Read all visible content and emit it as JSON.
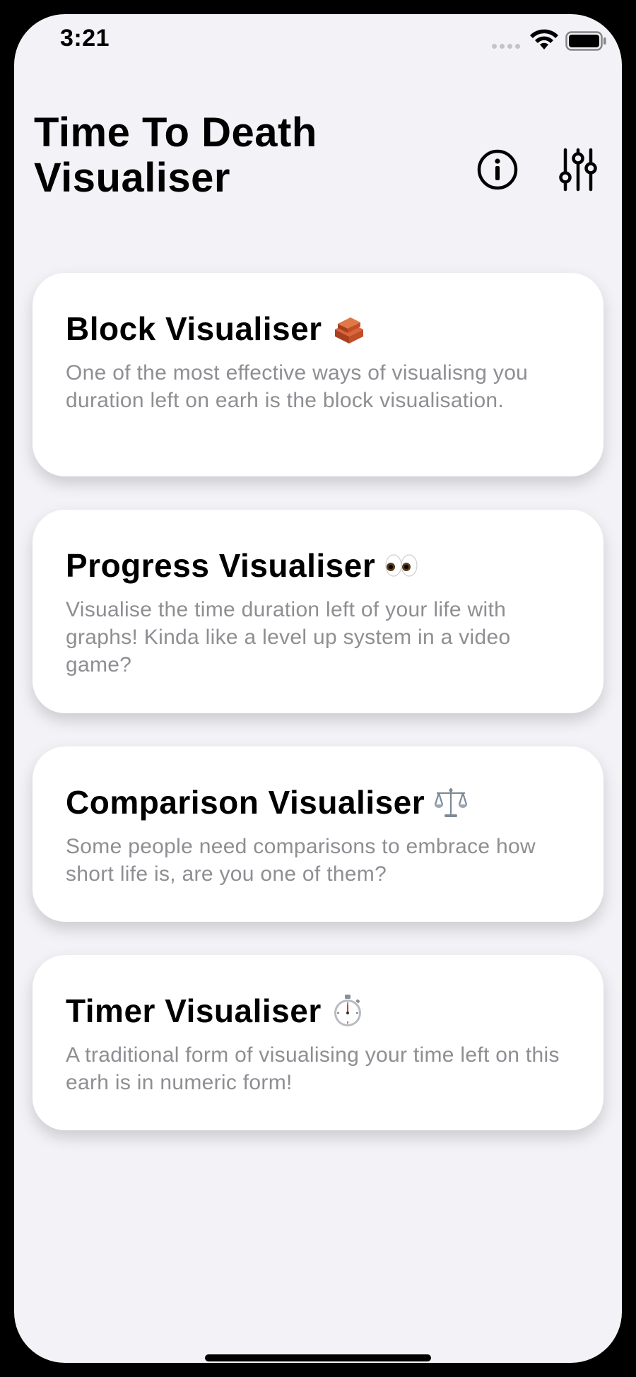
{
  "status_bar": {
    "time": "3:21"
  },
  "header": {
    "title": "Time To Death Visualiser",
    "info_icon": "info-circle-icon",
    "settings_icon": "sliders-icon"
  },
  "cards": [
    {
      "title": "Block Visualiser",
      "emoji": "brick-icon",
      "description": "One of the most effective ways of visualisng you duration left on earh is the block visualisation."
    },
    {
      "title": "Progress Visualiser",
      "emoji": "eyes-icon",
      "description": "Visualise the time duration left of your life with graphs! Kinda like a level up system in a video game?"
    },
    {
      "title": "Comparison Visualiser",
      "emoji": "balance-scale-icon",
      "description": "Some people need comparisons to embrace how short life is, are you one of them?"
    },
    {
      "title": "Timer Visualiser",
      "emoji": "stopwatch-icon",
      "description": "A traditional form of visualising your time left on this earh is in numeric form!"
    }
  ],
  "colors": {
    "background": "#f2f2f7",
    "card": "#ffffff",
    "title_text": "#000000",
    "description_text": "#8e8e93"
  }
}
